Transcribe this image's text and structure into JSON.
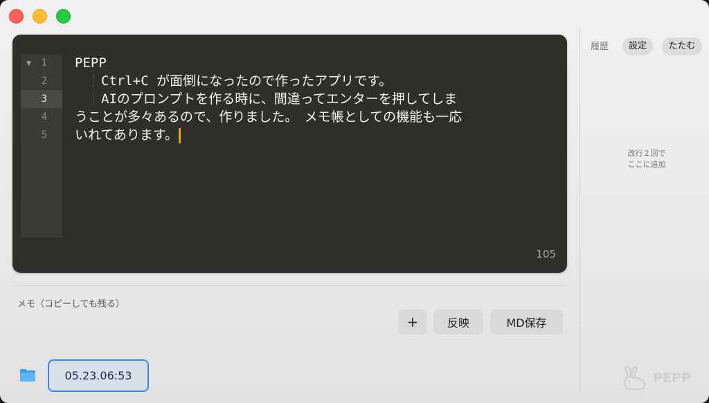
{
  "window": {
    "controls": [
      "close",
      "minimize",
      "zoom"
    ]
  },
  "editor": {
    "line_numbers": [
      "1",
      "2",
      "3",
      "4",
      "5"
    ],
    "active_line": "3",
    "lines": [
      "PEPP",
      "　　Ctrl+C が面倒になったので作ったアプリです。",
      "　　AIのプロンプトを作る時に、間違ってエンターを押してしま",
      "うことが多々あるので、作りました。　メモ帳としての機能も一応",
      "いれてあります。"
    ],
    "char_count": "105"
  },
  "memo": {
    "label": "メモ（コピーしても残る）"
  },
  "toolbar": {
    "add_label": "+",
    "reflect_label": "反映",
    "md_save_label": "MD保存"
  },
  "bottom": {
    "folder_icon": "folder-icon",
    "history_time": "05.23.06:53"
  },
  "sidebar": {
    "history_label": "履歴",
    "settings_label": "設定",
    "fold_label": "たたむ",
    "hint_line1": "改行２回で",
    "hint_line2": "ここに追加"
  },
  "brand": {
    "logo_text": "PEPP",
    "logo_icon": "rabbit-icon"
  },
  "colors": {
    "editor_bg": "#2e2e2a",
    "caret": "#f0a020",
    "selection_border": "#3b82f6",
    "close": "#fe5f57",
    "minimize": "#febc2e",
    "zoom": "#28c840"
  }
}
